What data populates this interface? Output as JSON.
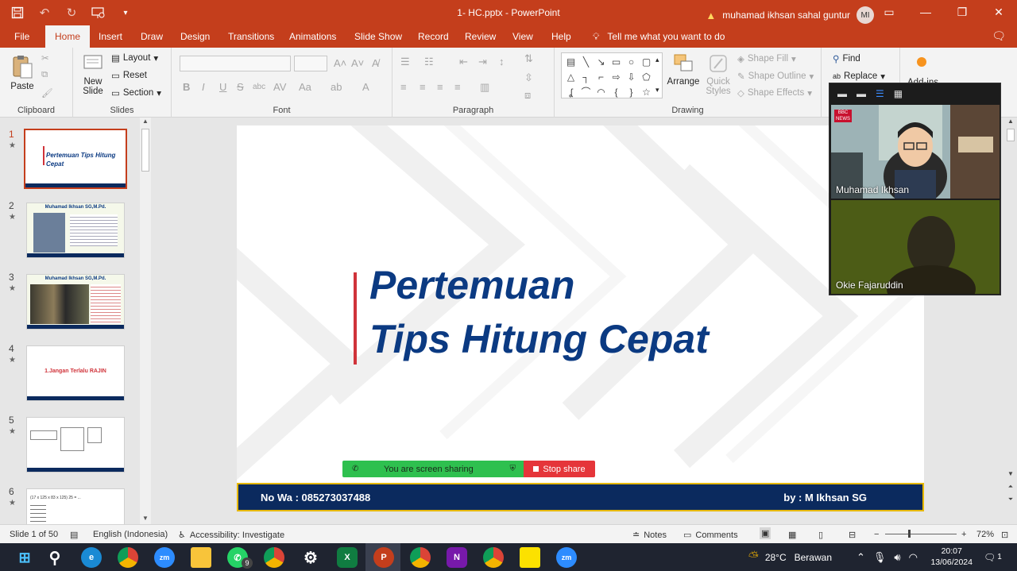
{
  "titlebar": {
    "doc_title": "1- HC.pptx  -  PowerPoint",
    "user_name": "muhamad ikhsan sahal guntur",
    "user_initials": "MI"
  },
  "tabs": [
    "File",
    "Home",
    "Insert",
    "Draw",
    "Design",
    "Transitions",
    "Animations",
    "Slide Show",
    "Record",
    "Review",
    "View",
    "Help"
  ],
  "tell_me": "Tell me what you want to do",
  "ribbon": {
    "clipboard": {
      "paste": "Paste",
      "label": "Clipboard"
    },
    "slides": {
      "new_slide": "New",
      "new_slide2": "Slide",
      "layout": "Layout",
      "reset": "Reset",
      "section": "Section",
      "label": "Slides"
    },
    "font": {
      "label": "Font"
    },
    "paragraph": {
      "label": "Paragraph"
    },
    "drawing": {
      "arrange": "Arrange",
      "quick_styles": "Quick",
      "quick_styles2": "Styles",
      "shape_fill": "Shape Fill",
      "shape_outline": "Shape Outline",
      "shape_effects": "Shape Effects",
      "label": "Drawing"
    },
    "editing": {
      "find": "Find",
      "replace": "Replace",
      "addins": "Add-ins"
    }
  },
  "thumbnails": [
    {
      "num": "1",
      "title": "Pertemuan Tips Hitung Cepat"
    },
    {
      "num": "2",
      "title": "Muhamad Ikhsan SG,M.Pd."
    },
    {
      "num": "3",
      "title": "Muhamad Ikhsan SG,M.Pd."
    },
    {
      "num": "4",
      "title": "1.Jangan Terlalu RAJIN"
    },
    {
      "num": "5",
      "title": ""
    },
    {
      "num": "6",
      "title": "(17 x 125 x 83 x 125) 25 = ..."
    }
  ],
  "slide": {
    "line1": "Pertemuan",
    "line2": "Tips Hitung Cepat",
    "footer_left": "No Wa : 085273037488",
    "footer_right": "by : M Ikhsan SG"
  },
  "share": {
    "sharing_text": "You are screen sharing",
    "stop_text": "Stop share"
  },
  "video": {
    "participant1": "Muhamad Ikhsan",
    "participant2": "Okie Fajaruddin"
  },
  "status": {
    "slide_info": "Slide 1 of 50",
    "language": "English (Indonesia)",
    "accessibility": "Accessibility: Investigate",
    "notes": "Notes",
    "comments": "Comments",
    "zoom": "72%"
  },
  "taskbar": {
    "temperature": "28°C",
    "weather": "Berawan",
    "time": "20:07",
    "date": "13/06/2024",
    "notif_count": "1",
    "whatsapp_badge": "9"
  },
  "colors": {
    "accent": "#c43e1c",
    "slide_title": "#0b3a82",
    "footer_bg": "#0b2a5e"
  }
}
